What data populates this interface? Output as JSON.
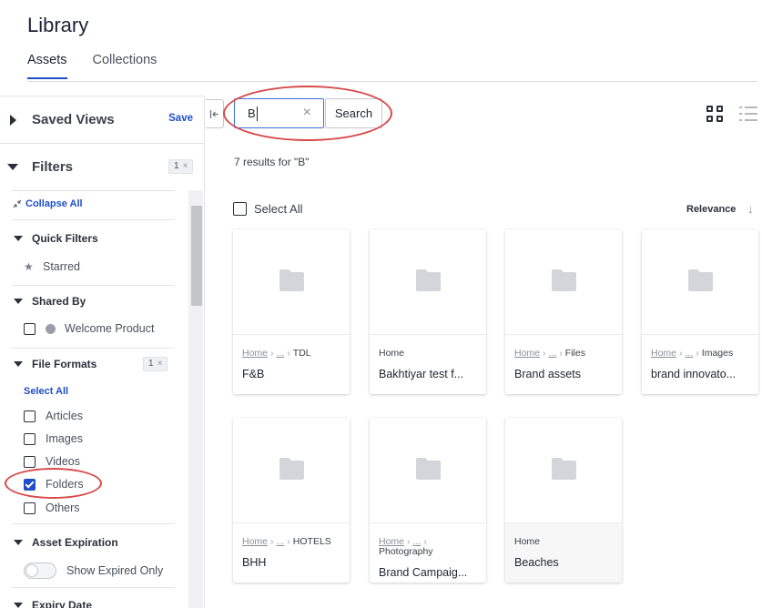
{
  "header": {
    "title": "Library",
    "tabs": [
      {
        "label": "Assets",
        "active": true
      },
      {
        "label": "Collections",
        "active": false
      }
    ]
  },
  "sidebar": {
    "saved_views": {
      "title": "Saved Views",
      "save_label": "Save"
    },
    "filters": {
      "title": "Filters",
      "count": "1"
    },
    "collapse_all": "Collapse All",
    "quick_filters": {
      "title": "Quick Filters",
      "items": [
        "Starred"
      ]
    },
    "shared_by": {
      "title": "Shared By",
      "items": [
        "Welcome Product"
      ]
    },
    "file_formats": {
      "title": "File Formats",
      "count": "1",
      "select_all": "Select All",
      "options": [
        {
          "label": "Articles",
          "checked": false
        },
        {
          "label": "Images",
          "checked": false
        },
        {
          "label": "Videos",
          "checked": false
        },
        {
          "label": "Folders",
          "checked": true
        },
        {
          "label": "Others",
          "checked": false
        }
      ]
    },
    "asset_expiration": {
      "title": "Asset Expiration",
      "toggle_label": "Show Expired Only",
      "toggle_on": false
    },
    "expiry_date": {
      "title": "Expiry Date"
    }
  },
  "search": {
    "value": "B",
    "button_label": "Search"
  },
  "results": {
    "summary": "7 results for \"B\""
  },
  "toolbar": {
    "select_all": "Select All",
    "sort_label": "Relevance",
    "active_view": "grid"
  },
  "assets": [
    {
      "crumbs": [
        "Home",
        "...",
        "TDL"
      ],
      "name": "F&B"
    },
    {
      "crumbs": [
        "Home"
      ],
      "name": "Bakhtiyar test f..."
    },
    {
      "crumbs": [
        "Home",
        "...",
        "Files"
      ],
      "name": "Brand assets"
    },
    {
      "crumbs": [
        "Home",
        "...",
        "Images"
      ],
      "name": "brand innovato..."
    },
    {
      "crumbs": [
        "Home",
        "...",
        "HOTELS"
      ],
      "name": "BHH"
    },
    {
      "crumbs": [
        "Home",
        "...",
        ""
      ],
      "crumb_line2": "Photography",
      "name": "Brand Campaig..."
    },
    {
      "crumbs": [
        "Home"
      ],
      "name": "Beaches"
    }
  ],
  "colors": {
    "accent": "#1e4fc9",
    "annotation": "#d84a4a",
    "folder": "#d4d5da"
  }
}
